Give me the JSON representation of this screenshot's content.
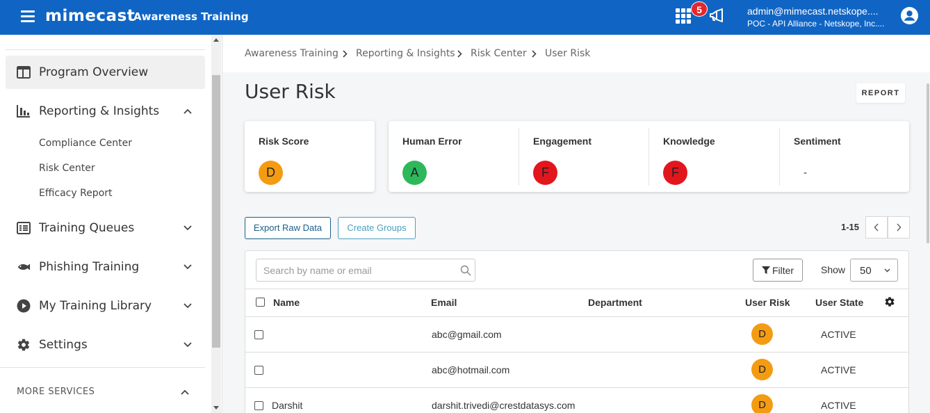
{
  "colors": {
    "header_bg": "#1065c4",
    "grade_d": "#f39c12",
    "grade_a": "#2eb85c",
    "grade_f": "#e3161e",
    "badge": "#e3262d",
    "export_btn": "#1a5f8a",
    "create_btn": "#4a9fc0"
  },
  "header": {
    "brand": "mimecast",
    "product": "Awareness Training",
    "notification_count": "5",
    "user_email": "admin@mimecast.netskope....",
    "user_org": "POC - API Alliance - Netskope, Inc...."
  },
  "sidebar": {
    "items": [
      {
        "label": "Program Overview",
        "icon": "program-overview-icon"
      },
      {
        "label": "Reporting & Insights",
        "icon": "bar-chart-icon"
      },
      {
        "label": "Training Queues",
        "icon": "list-icon"
      },
      {
        "label": "Phishing Training",
        "icon": "fish-icon"
      },
      {
        "label": "My Training Library",
        "icon": "play-circle-icon"
      },
      {
        "label": "Settings",
        "icon": "gear-icon"
      }
    ],
    "sub_items": [
      "Compliance Center",
      "Risk Center",
      "Efficacy Report"
    ],
    "more_services": "MORE SERVICES"
  },
  "breadcrumb": [
    "Awareness Training",
    "Reporting & Insights",
    "Risk Center",
    "User Risk"
  ],
  "page": {
    "title": "User Risk",
    "report_button": "REPORT"
  },
  "metrics": {
    "risk_score": {
      "label": "Risk Score",
      "grade": "D"
    },
    "human_error": {
      "label": "Human Error",
      "grade": "A"
    },
    "engagement": {
      "label": "Engagement",
      "grade": "F"
    },
    "knowledge": {
      "label": "Knowledge",
      "grade": "F"
    },
    "sentiment": {
      "label": "Sentiment",
      "value": "-"
    }
  },
  "actions": {
    "export_raw_data": "Export Raw Data",
    "create_groups": "Create Groups",
    "pager_range": "1-15"
  },
  "table": {
    "search_placeholder": "Search by name or email",
    "filter_label": "Filter",
    "show_label": "Show",
    "show_value": "50",
    "columns": [
      "Name",
      "Email",
      "Department",
      "User Risk",
      "User State"
    ],
    "rows": [
      {
        "name": "",
        "email": "abc@gmail.com",
        "department": "",
        "risk": "D",
        "state": "ACTIVE"
      },
      {
        "name": "",
        "email": "abc@hotmail.com",
        "department": "",
        "risk": "D",
        "state": "ACTIVE"
      },
      {
        "name": "Darshit",
        "email": "darshit.trivedi@crestdatasys.com",
        "department": "",
        "risk": "D",
        "state": "ACTIVE"
      }
    ]
  }
}
